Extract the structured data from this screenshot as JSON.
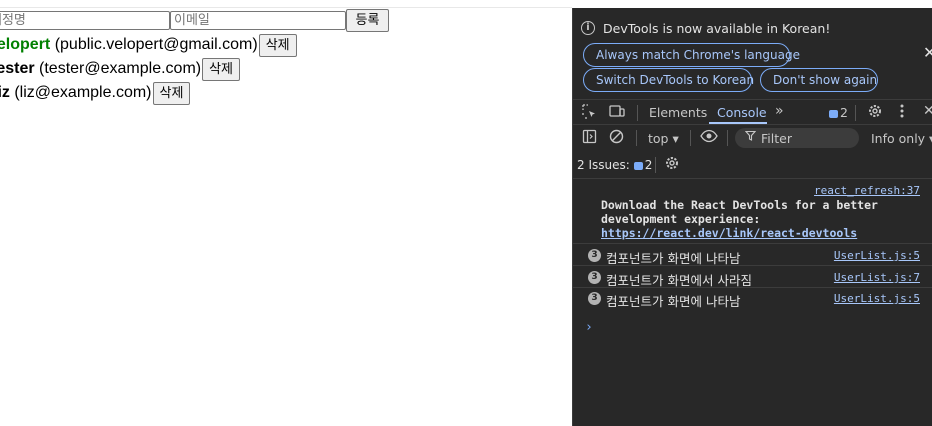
{
  "page": {
    "form": {
      "name_placeholder": "계정명",
      "email_placeholder": "이메일",
      "register_label": "등록"
    },
    "users": [
      {
        "username": "velopert",
        "email": "(public.velopert@gmail.com)",
        "delete_label": "삭제",
        "active": true
      },
      {
        "username": "tester",
        "email": "(tester@example.com)",
        "delete_label": "삭제",
        "active": false
      },
      {
        "username": "liz",
        "email": "(liz@example.com)",
        "delete_label": "삭제",
        "active": false
      }
    ]
  },
  "devtools": {
    "infobar": {
      "message": "DevTools is now available in Korean!",
      "match_language": "Always match Chrome's language",
      "switch_korean": "Switch DevTools to Korean",
      "dont_show": "Don't show again"
    },
    "tabs": {
      "elements": "Elements",
      "console": "Console",
      "more": "»",
      "issues_count": "2"
    },
    "toolbar": {
      "context": "top ▾",
      "filter_placeholder": "Filter",
      "level": "Info only ▾"
    },
    "issues": {
      "label": "2 Issues:",
      "count": "2"
    },
    "console": {
      "react_source": "react_refresh:37",
      "react_message": "Download the React DevTools for a better\ndevelopment experience:",
      "react_link": "https://react.dev/link/react-devtools",
      "logs": [
        {
          "count": "3",
          "text": "컴포넌트가 화면에 나타남",
          "source": "UserList.js:5"
        },
        {
          "count": "3",
          "text": "컴포넌트가 화면에서 사라짐",
          "source": "UserList.js:7"
        },
        {
          "count": "3",
          "text": "컴포넌트가 화면에 나타남",
          "source": "UserList.js:5"
        }
      ],
      "prompt": "›"
    },
    "colors": {
      "background": "#282828",
      "accent": "#a8c7fa",
      "active_user": "#008000"
    }
  }
}
